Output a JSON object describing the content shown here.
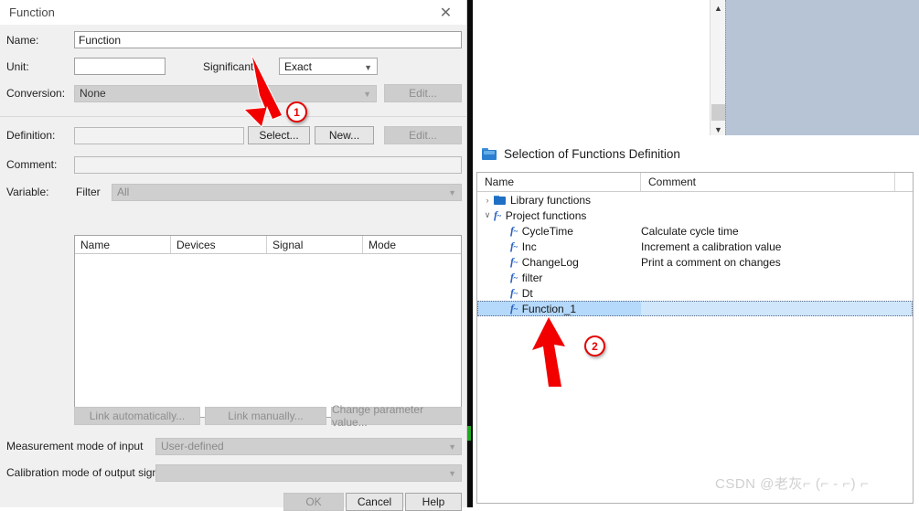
{
  "background": {
    "name": "background-window"
  },
  "function_dialog": {
    "title": "Function",
    "close_icon": "close-icon",
    "fields": {
      "name_label": "Name:",
      "name_value": "Function",
      "unit_label": "Unit:",
      "unit_value": "",
      "significant_label": "Significant",
      "significant_value": "Exact",
      "conversion_label": "Conversion:",
      "conversion_value": "None",
      "conversion_edit": "Edit...",
      "definition_label": "Definition:",
      "definition_value": "",
      "definition_select": "Select...",
      "definition_new": "New...",
      "definition_edit": "Edit...",
      "comment_label": "Comment:",
      "comment_value": "",
      "variable_label": "Variable:",
      "filter_label": "Filter",
      "filter_value": "All"
    },
    "grid": {
      "columns": [
        "Name",
        "Devices",
        "Signal",
        "Mode"
      ],
      "rows": []
    },
    "link_buttons": [
      "Link automatically...",
      "Link manually...",
      "Change parameter value..."
    ],
    "measurement_mode_label": "Measurement mode of input",
    "measurement_mode_value": "User-defined",
    "calibration_mode_label": "Calibration mode of output signals:",
    "calibration_mode_value": "",
    "footer_buttons": [
      "OK",
      "Cancel",
      "Help"
    ]
  },
  "selection_dialog": {
    "title": "Selection of Functions Definition",
    "title_icon": "folder-icon",
    "columns": [
      "Name",
      "Comment"
    ],
    "tree": [
      {
        "label": "Library functions",
        "comment": "",
        "icon": "folder-icon",
        "twisty": "›",
        "depth": 0,
        "selected": false
      },
      {
        "label": "Project functions",
        "comment": "",
        "icon": "fx-icon",
        "twisty": "∨",
        "depth": 0,
        "selected": false
      },
      {
        "label": "CycleTime",
        "comment": "Calculate cycle time",
        "icon": "fx-icon",
        "twisty": "",
        "depth": 1,
        "selected": false
      },
      {
        "label": "Inc",
        "comment": "Increment a calibration value",
        "icon": "fx-icon",
        "twisty": "",
        "depth": 1,
        "selected": false
      },
      {
        "label": "ChangeLog",
        "comment": "Print a comment on changes",
        "icon": "fx-icon",
        "twisty": "",
        "depth": 1,
        "selected": false
      },
      {
        "label": "filter",
        "comment": "",
        "icon": "fx-icon",
        "twisty": "",
        "depth": 1,
        "selected": false
      },
      {
        "label": "Dt",
        "comment": "",
        "icon": "fx-icon",
        "twisty": "",
        "depth": 1,
        "selected": false
      },
      {
        "label": "Function_1",
        "comment": "",
        "icon": "fx-icon",
        "twisty": "",
        "depth": 1,
        "selected": true
      }
    ]
  },
  "annotations": {
    "marker_1": "1",
    "marker_2": "2",
    "arrow_color": "#e60000"
  },
  "watermark": "CSDN @老灰⌐ (⌐ - ⌐) ⌐"
}
